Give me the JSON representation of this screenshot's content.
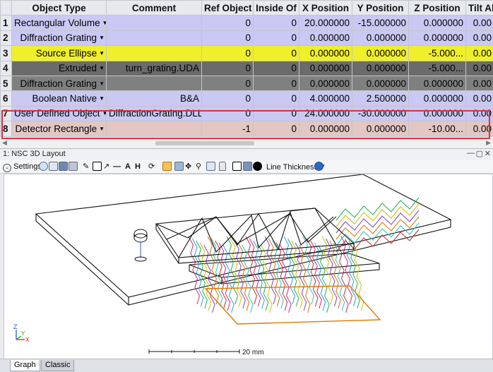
{
  "table": {
    "headers": [
      "Object Type",
      "Comment",
      "Ref Object",
      "Inside Of",
      "X Position",
      "Y Position",
      "Z Position",
      "Tilt Ab"
    ],
    "rows": [
      {
        "n": "1",
        "type": "Rectangular Volume",
        "comment": "",
        "ref": "0",
        "inside": "0",
        "x": "20.000000",
        "y": "-15.000000",
        "z": "0.000000",
        "tilt": "0.00"
      },
      {
        "n": "2",
        "type": "Diffraction Grating",
        "comment": "",
        "ref": "0",
        "inside": "0",
        "x": "0.000000",
        "y": "0.000000",
        "z": "0.000000",
        "tilt": "0.00"
      },
      {
        "n": "3",
        "type": "Source Ellipse",
        "comment": "",
        "ref": "0",
        "inside": "0",
        "x": "0.000000",
        "y": "0.000000",
        "z": "-5.000...",
        "tilt": "0.00"
      },
      {
        "n": "4",
        "type": "Extruded",
        "comment": "turn_grating.UDA",
        "ref": "0",
        "inside": "0",
        "x": "0.000000",
        "y": "0.000000",
        "z": "-5.000...",
        "tilt": "0.00"
      },
      {
        "n": "5",
        "type": "Diffraction Grating",
        "comment": "",
        "ref": "0",
        "inside": "0",
        "x": "0.000000",
        "y": "0.000000",
        "z": "0.000000",
        "tilt": "0.00"
      },
      {
        "n": "6",
        "type": "Boolean Native",
        "comment": "B&A",
        "ref": "0",
        "inside": "0",
        "x": "4.000000",
        "y": "2.500000",
        "z": "0.000000",
        "tilt": "0.00"
      },
      {
        "n": "7",
        "type": "User Defined Object",
        "comment": "DiffractionGrating.DLL",
        "ref": "0",
        "inside": "0",
        "x": "24.000000",
        "y": "-30.000000",
        "z": "0.000000",
        "tilt": "0.00"
      },
      {
        "n": "8",
        "type": "Detector Rectangle",
        "comment": "",
        "ref": "-1",
        "inside": "0",
        "x": "0.000000",
        "y": "0.000000",
        "z": "-10.00...",
        "tilt": "0.00"
      }
    ]
  },
  "window": {
    "title": "1: NSC 3D Layout"
  },
  "toolbar": {
    "settings": "Settings",
    "line_thickness": "Line Thickness"
  },
  "plot": {
    "scale_label": "20 mm",
    "axis_z": "Z",
    "axis_y": "Y",
    "axis_x": "X"
  },
  "tabs": {
    "graph": "Graph",
    "classic": "Classic"
  },
  "icons": [
    "chevron-down-icon",
    "refresh-icon",
    "copy-icon",
    "save-icon",
    "print-icon",
    "pencil-icon",
    "rectangle-icon",
    "arrow-icon",
    "line-icon",
    "text-icon",
    "dimension-icon",
    "rotate-icon",
    "axes-icon",
    "fit-icon",
    "pan-icon",
    "zoom-icon",
    "zoom-box-icon",
    "lock-icon",
    "layers-icon",
    "grid-icon",
    "window-icon",
    "clock-icon",
    "help-icon"
  ]
}
